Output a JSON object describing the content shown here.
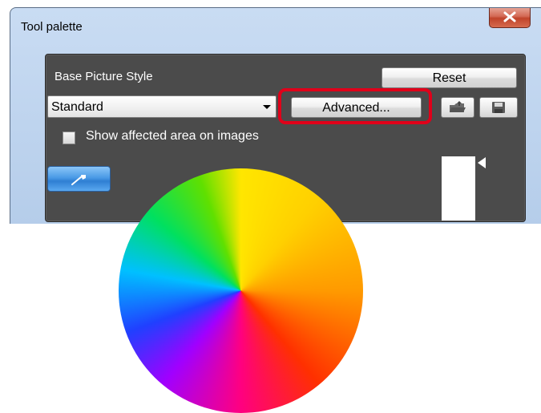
{
  "window": {
    "title": "Tool palette"
  },
  "base_picture_style": {
    "label": "Base Picture Style",
    "selected": "Standard",
    "reset_label": "Reset",
    "advanced_label": "Advanced..."
  },
  "options": {
    "show_affected_label": "Show affected area on images",
    "show_affected_checked": false
  },
  "icons": {
    "close": "close-icon",
    "load": "folder-load-icon",
    "save": "floppy-save-icon",
    "eyedropper": "eyedropper-icon"
  },
  "colors": {
    "panel_bg": "#4b4b4b",
    "highlight": "#e0001a",
    "accent_blue": "#4a9ae6"
  }
}
